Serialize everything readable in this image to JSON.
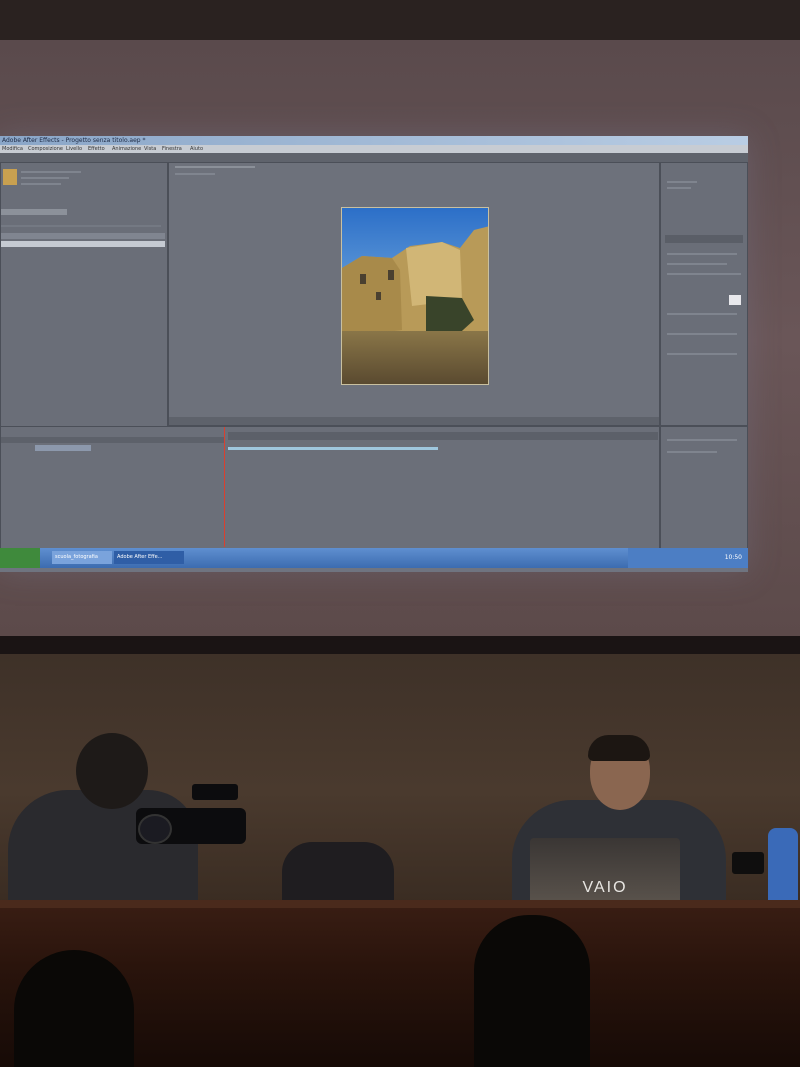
{
  "app": {
    "title": "Adobe After Effects - Progetto senza titolo.aep *",
    "menu": [
      "Modifica",
      "Composizione",
      "Livello",
      "Effetto",
      "Animazione",
      "Vista",
      "Finestra",
      "Aiuto"
    ],
    "taskbar": {
      "items": [
        "scuola_fotografia",
        "Adobe After Effe..."
      ],
      "clock": "10:50"
    }
  },
  "laptop": {
    "brand": "VAIO"
  }
}
